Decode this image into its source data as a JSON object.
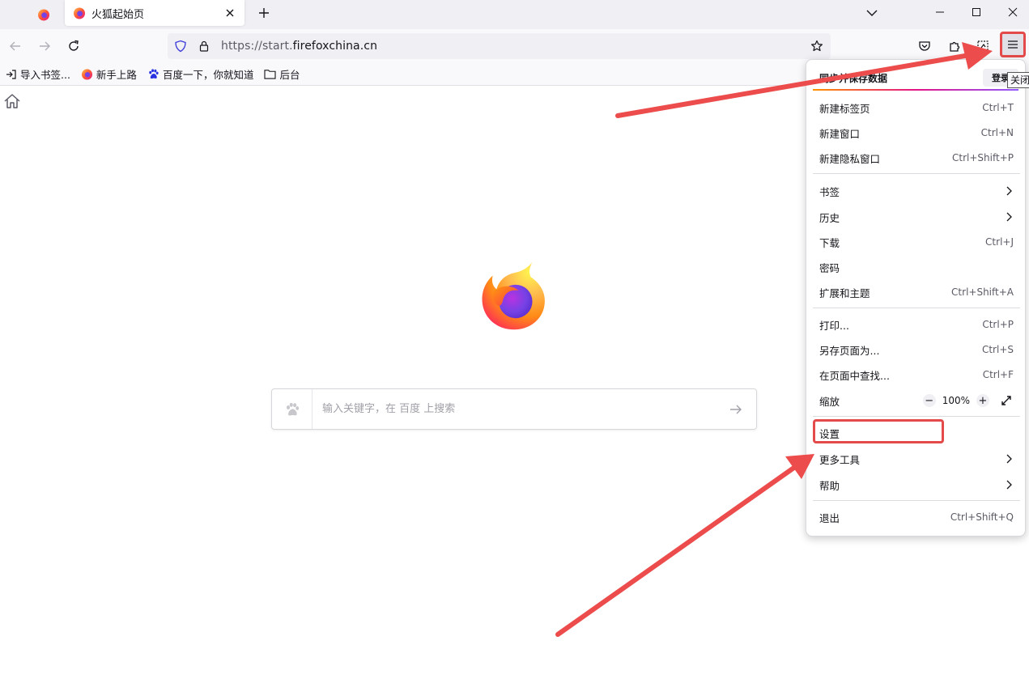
{
  "tabs": {
    "pinned_icon": "firefox-icon",
    "active": {
      "title": "火狐起始页",
      "icon": "firefox-icon"
    }
  },
  "urlbar": {
    "url_prefix": "https://start.",
    "url_domain": "firefoxchina.cn"
  },
  "bookmarks": [
    {
      "label": "导入书签...",
      "icon": "import-icon"
    },
    {
      "label": "新手上路",
      "icon": "firefox-icon"
    },
    {
      "label": "百度一下，你就知道",
      "icon": "baidu-paw-icon"
    },
    {
      "label": "后台",
      "icon": "folder-icon"
    }
  ],
  "search": {
    "placeholder": "输入关键字，在 百度 上搜索"
  },
  "menu": {
    "sync_text": "同步并保存数据",
    "sync_login": "登录",
    "tooltip": "关闭",
    "items": [
      {
        "label": "新建标签页",
        "shortcut": "Ctrl+T"
      },
      {
        "label": "新建窗口",
        "shortcut": "Ctrl+N"
      },
      {
        "label": "新建隐私窗口",
        "shortcut": "Ctrl+Shift+P"
      },
      {
        "label": "书签",
        "shortcut": ""
      },
      {
        "label": "历史",
        "shortcut": ""
      },
      {
        "label": "下载",
        "shortcut": "Ctrl+J"
      },
      {
        "label": "密码",
        "shortcut": ""
      },
      {
        "label": "扩展和主题",
        "shortcut": "Ctrl+Shift+A"
      },
      {
        "label": "打印...",
        "shortcut": "Ctrl+P"
      },
      {
        "label": "另存页面为...",
        "shortcut": "Ctrl+S"
      },
      {
        "label": "在页面中查找...",
        "shortcut": "Ctrl+F"
      },
      {
        "label": "缩放",
        "shortcut": ""
      },
      {
        "label": "设置",
        "shortcut": ""
      },
      {
        "label": "更多工具",
        "shortcut": ""
      },
      {
        "label": "帮助",
        "shortcut": ""
      },
      {
        "label": "退出",
        "shortcut": "Ctrl+Shift+Q"
      }
    ],
    "zoom": {
      "minus": "−",
      "value": "100%",
      "plus": "+"
    }
  },
  "colors": {
    "annotation_red": "#e44a4a",
    "toolbar": "#f9f9fb",
    "tabstrip": "#f0f0f4"
  }
}
